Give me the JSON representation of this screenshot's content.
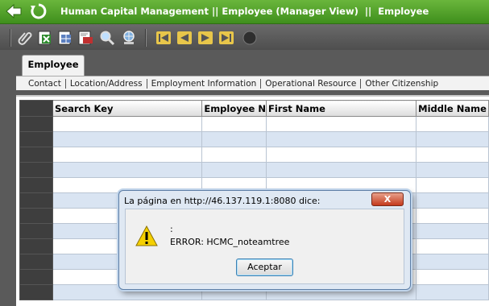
{
  "header": {
    "title": "Human Capital Management || Employee (Manager View)  ||  Employee",
    "back_icon": "arrow-left-icon",
    "refresh_icon": "refresh-icon"
  },
  "toolbar": {
    "icons": [
      "paperclip-icon",
      "excel-export-icon",
      "grid-export-icon",
      "pdf-export-icon",
      "search-icon",
      "globe-search-icon",
      "first-record-icon",
      "previous-record-icon",
      "next-record-icon",
      "last-record-icon",
      "status-indicator-icon"
    ]
  },
  "tabs": {
    "active": "Employee"
  },
  "subtabs": [
    "Contact",
    "Location/Address",
    "Employment Information",
    "Operational Resource",
    "Other Citizenship"
  ],
  "grid": {
    "columns": [
      "Search Key",
      "Employee N",
      "First Name",
      "Middle Name"
    ]
  },
  "dialog": {
    "caption": "La página en http://46.137.119.1:8080 dice:",
    "close_label": "X",
    "line1": ":",
    "line2": "ERROR: HCMC_noteamtree",
    "ok_label": "Aceptar"
  },
  "colors": {
    "header_green": "#3f8f1c",
    "row_alt": "#d9e4f2",
    "dialog_border": "#5d7ea6"
  }
}
